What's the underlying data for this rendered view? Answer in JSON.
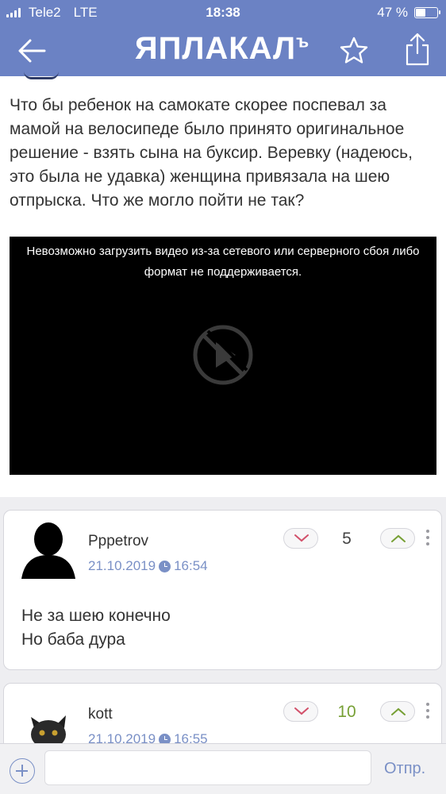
{
  "status_bar": {
    "carrier": "Tele2",
    "network": "LTE",
    "time": "18:38",
    "battery": "47 %",
    "battery_level": 0.47
  },
  "header": {
    "logo": "ЯПЛАКАЛ",
    "logo_suffix": "ъ"
  },
  "post": {
    "text": "Что бы ребенок на самокате скорее поспевал за мамой на велосипеде было принято оригинальное решение - взять сына на буксир. Веревку (надеюсь, это была не удавка) женщина привязала на шею отпрыска. Что же могло пойти не так?",
    "video_error": "Невозможно загрузить видео из-за сетевого или серверного сбоя либо формат не поддерживается."
  },
  "comments": [
    {
      "author": "Pppetrov",
      "date": "21.10.2019",
      "time": "16:54",
      "score": "5",
      "lines": [
        "Не за шею конечно",
        "Но баба дура"
      ]
    },
    {
      "author": "kott",
      "date": "21.10.2019",
      "time": "16:55",
      "score": "10"
    }
  ],
  "bottom_bar": {
    "placeholder": "",
    "send_label": "Отпр."
  },
  "colors": {
    "header": "#6b82c4",
    "accent": "#7a90c6",
    "positive": "#77a035"
  }
}
